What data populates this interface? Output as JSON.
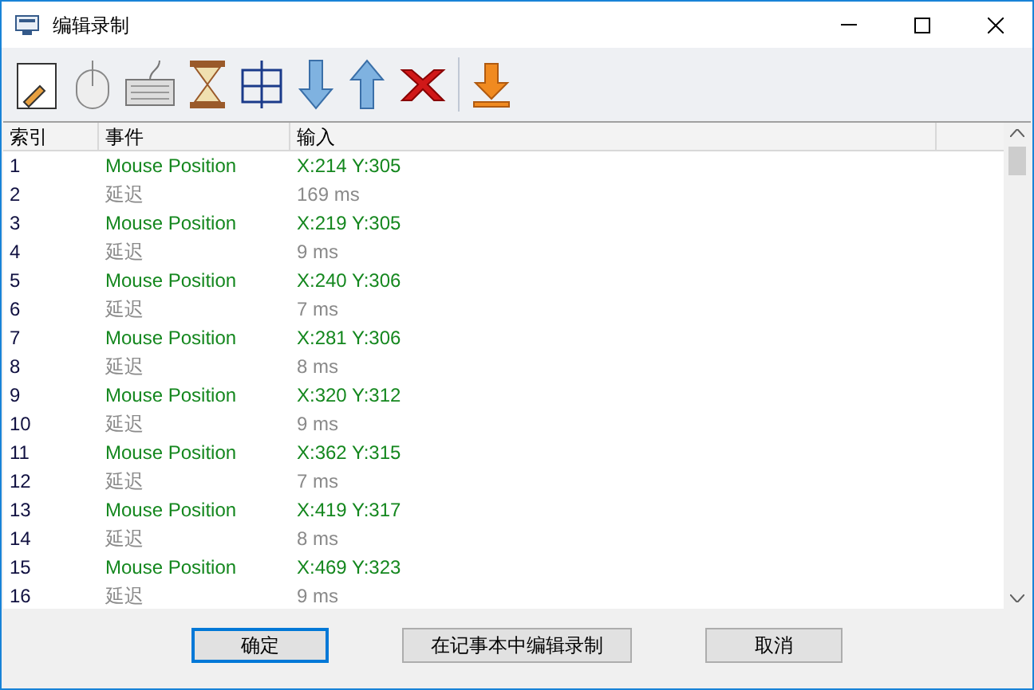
{
  "window": {
    "title": "编辑录制"
  },
  "table": {
    "columns": [
      "索引",
      "事件",
      "输入"
    ],
    "rows": [
      {
        "index": "1",
        "event": "Mouse Position",
        "input": "X:214 Y:305",
        "kind": "mouse"
      },
      {
        "index": "2",
        "event": "延迟",
        "input": "169 ms",
        "kind": "delay"
      },
      {
        "index": "3",
        "event": "Mouse Position",
        "input": "X:219 Y:305",
        "kind": "mouse"
      },
      {
        "index": "4",
        "event": "延迟",
        "input": "9 ms",
        "kind": "delay"
      },
      {
        "index": "5",
        "event": "Mouse Position",
        "input": "X:240 Y:306",
        "kind": "mouse"
      },
      {
        "index": "6",
        "event": "延迟",
        "input": "7 ms",
        "kind": "delay"
      },
      {
        "index": "7",
        "event": "Mouse Position",
        "input": "X:281 Y:306",
        "kind": "mouse"
      },
      {
        "index": "8",
        "event": "延迟",
        "input": "8 ms",
        "kind": "delay"
      },
      {
        "index": "9",
        "event": "Mouse Position",
        "input": "X:320 Y:312",
        "kind": "mouse"
      },
      {
        "index": "10",
        "event": "延迟",
        "input": "9 ms",
        "kind": "delay"
      },
      {
        "index": "11",
        "event": "Mouse Position",
        "input": "X:362 Y:315",
        "kind": "mouse"
      },
      {
        "index": "12",
        "event": "延迟",
        "input": "7 ms",
        "kind": "delay"
      },
      {
        "index": "13",
        "event": "Mouse Position",
        "input": "X:419 Y:317",
        "kind": "mouse"
      },
      {
        "index": "14",
        "event": "延迟",
        "input": "8 ms",
        "kind": "delay"
      },
      {
        "index": "15",
        "event": "Mouse Position",
        "input": "X:469 Y:323",
        "kind": "mouse"
      },
      {
        "index": "16",
        "event": "延迟",
        "input": "9 ms",
        "kind": "delay"
      }
    ]
  },
  "buttons": [
    {
      "label": "确定",
      "default": true
    },
    {
      "label": "在记事本中编辑录制",
      "default": false
    },
    {
      "label": "取消",
      "default": false
    }
  ]
}
